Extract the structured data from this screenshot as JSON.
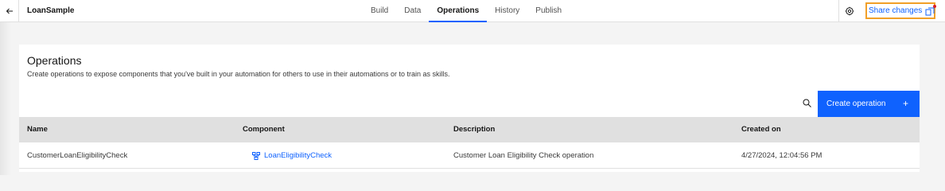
{
  "topbar": {
    "back_icon": "arrow-left-icon",
    "app_name": "LoanSample",
    "tabs": [
      {
        "label": "Build",
        "active": false
      },
      {
        "label": "Data",
        "active": false
      },
      {
        "label": "Operations",
        "active": true
      },
      {
        "label": "History",
        "active": false
      },
      {
        "label": "Publish",
        "active": false
      }
    ],
    "settings_icon": "settings-icon",
    "share_label": "Share changes",
    "share_icon": "share-changes-icon"
  },
  "main": {
    "title": "Operations",
    "description": "Create operations to expose components that you've built in your automation for others to use in their automations or to train as skills.",
    "search_icon": "search-icon",
    "create_label": "Create operation",
    "create_icon": "+"
  },
  "table": {
    "headers": [
      "Name",
      "Component",
      "Description",
      "Created on"
    ],
    "rows": [
      {
        "name": "CustomerLoanEligibilityCheck",
        "component": "LoanEligibilityCheck",
        "component_icon": "component-flow-icon",
        "description": "Customer Loan Eligibility Check operation",
        "created_on": "4/27/2024, 12:04:56 PM"
      }
    ]
  },
  "colors": {
    "accent": "#0f62fe",
    "highlight_border": "#f1a028",
    "notification_dot": "#da1e28"
  }
}
